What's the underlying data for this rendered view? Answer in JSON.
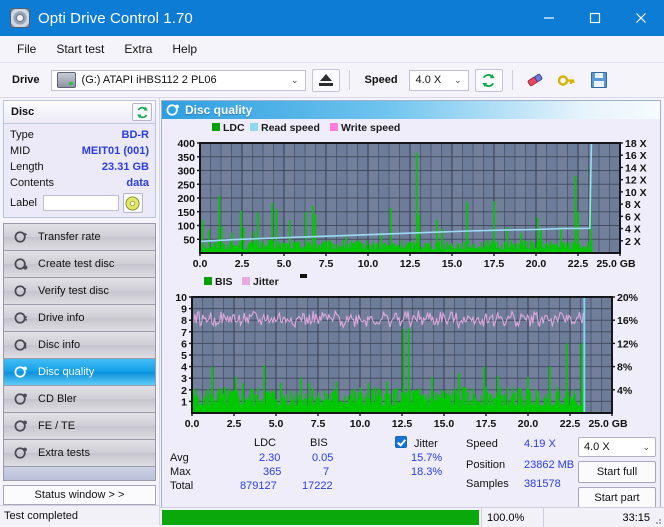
{
  "window": {
    "title": "Opti Drive Control 1.70",
    "app_icon": "disc-icon",
    "minimize": "–",
    "maximize": "□",
    "close": "✕"
  },
  "menu": {
    "items": [
      {
        "label": "File"
      },
      {
        "label": "Start test"
      },
      {
        "label": "Extra"
      },
      {
        "label": "Help"
      }
    ]
  },
  "toolbar": {
    "drive_label": "Drive",
    "drive_value": "(G:)  ATAPI iHBS112  2 PL06",
    "eject_icon": "eject-icon",
    "speed_label": "Speed",
    "speed_value": "4.0 X",
    "refresh_icon": "refresh-icon",
    "eraser_icon": "eraser-icon",
    "key_icon": "key-icon",
    "save_icon": "save-icon"
  },
  "sidebar": {
    "disc_panel": {
      "title": "Disc",
      "refresh_icon": "refresh-icon",
      "rows": [
        {
          "key": "Type",
          "value": "BD-R"
        },
        {
          "key": "MID",
          "value": "MEIT01 (001)"
        },
        {
          "key": "Length",
          "value": "23.31 GB"
        },
        {
          "key": "Contents",
          "value": "data"
        }
      ],
      "label_key": "Label",
      "label_value": "",
      "label_placeholder": "",
      "disc_icon": "cd-icon"
    },
    "nav_items": [
      {
        "label": "Transfer rate",
        "icon": "disc-test-icon",
        "active": false
      },
      {
        "label": "Create test disc",
        "icon": "disc-burn-icon",
        "active": false
      },
      {
        "label": "Verify test disc",
        "icon": "disc-verify-icon",
        "active": false
      },
      {
        "label": "Drive info",
        "icon": "drive-info-icon",
        "active": false
      },
      {
        "label": "Disc info",
        "icon": "disc-info-icon",
        "active": false
      },
      {
        "label": "Disc quality",
        "icon": "disc-quality-icon",
        "active": true
      },
      {
        "label": "CD Bler",
        "icon": "cd-bler-icon",
        "active": false
      },
      {
        "label": "FE / TE",
        "icon": "fe-te-icon",
        "active": false
      },
      {
        "label": "Extra tests",
        "icon": "extra-tests-icon",
        "active": false
      }
    ],
    "status_window_button": "Status window > >",
    "test_status": "Test completed"
  },
  "panel": {
    "title": "Disc quality",
    "icon": "disc-quality-icon"
  },
  "stats": {
    "col_headers": [
      "LDC",
      "BIS"
    ],
    "row_labels": [
      "Avg",
      "Max",
      "Total"
    ],
    "ldc": {
      "avg": "2.30",
      "max": "365",
      "total": "879127"
    },
    "bis": {
      "avg": "0.05",
      "max": "7",
      "total": "17222"
    },
    "jitter": {
      "label": "Jitter",
      "checked": true,
      "avg": "15.7%",
      "max": "18.3%"
    },
    "speed_label": "Speed",
    "speed_value": "4.19 X",
    "position_label": "Position",
    "position_value": "23862 MB",
    "samples_label": "Samples",
    "samples_value": "381578",
    "speed_select": "4.0 X",
    "start_full": "Start full",
    "start_part": "Start part"
  },
  "statusbar": {
    "progress_percent": 100,
    "percent_text": "100.0%",
    "elapsed": "33:15"
  },
  "chart_data": [
    {
      "type": "line",
      "name": "disc-quality-ldc-chart",
      "title": "",
      "xlabel": "GB",
      "ylabel": "LDC",
      "xlim": [
        0,
        25
      ],
      "xticks": [
        "0.0",
        "2.5",
        "5.0",
        "7.5",
        "10.0",
        "12.5",
        "15.0",
        "17.5",
        "20.0",
        "22.5",
        "25.0 GB"
      ],
      "ylim": [
        0,
        400
      ],
      "yticks": [
        "50",
        "100",
        "150",
        "200",
        "250",
        "300",
        "350",
        "400"
      ],
      "y2lim": [
        0,
        18
      ],
      "y2ticks": [
        "2 X",
        "4 X",
        "6 X",
        "8 X",
        "10 X",
        "12 X",
        "14 X",
        "16 X",
        "18 X"
      ],
      "legend": [
        {
          "label": "LDC",
          "color": "#00a000"
        },
        {
          "label": "Read speed",
          "color": "#8fd8f2"
        },
        {
          "label": "Write speed",
          "color": "#ff7fe0"
        }
      ],
      "legend_position": "top-left",
      "grid": true,
      "series": [
        {
          "name": "LDC",
          "color": "#00c800",
          "type": "impulse",
          "baseline_avg": 25,
          "peaks": [
            {
              "x": 0.15,
              "y": 120
            },
            {
              "x": 0.55,
              "y": 85
            },
            {
              "x": 1.15,
              "y": 208
            },
            {
              "x": 1.3,
              "y": 95
            },
            {
              "x": 1.9,
              "y": 75
            },
            {
              "x": 2.45,
              "y": 152
            },
            {
              "x": 2.6,
              "y": 92
            },
            {
              "x": 3.2,
              "y": 78
            },
            {
              "x": 3.45,
              "y": 148
            },
            {
              "x": 4.3,
              "y": 183
            },
            {
              "x": 4.55,
              "y": 160
            },
            {
              "x": 5.35,
              "y": 120
            },
            {
              "x": 6.3,
              "y": 149
            },
            {
              "x": 6.7,
              "y": 172
            },
            {
              "x": 6.85,
              "y": 140
            },
            {
              "x": 8.7,
              "y": 60
            },
            {
              "x": 10.8,
              "y": 72
            },
            {
              "x": 11.35,
              "y": 163
            },
            {
              "x": 12.9,
              "y": 365
            },
            {
              "x": 13.05,
              "y": 140
            },
            {
              "x": 14.1,
              "y": 120
            },
            {
              "x": 14.4,
              "y": 88
            },
            {
              "x": 15.9,
              "y": 185
            },
            {
              "x": 17.5,
              "y": 188
            },
            {
              "x": 18.3,
              "y": 95
            },
            {
              "x": 19.1,
              "y": 72
            },
            {
              "x": 20.1,
              "y": 130
            },
            {
              "x": 20.3,
              "y": 85
            },
            {
              "x": 21.5,
              "y": 95
            },
            {
              "x": 22.35,
              "y": 281
            },
            {
              "x": 22.5,
              "y": 150
            },
            {
              "x": 23.25,
              "y": 315
            }
          ]
        },
        {
          "name": "Read speed",
          "color": "#9bdcf5",
          "type": "line",
          "points": [
            {
              "x": 0.0,
              "y": 1.9
            },
            {
              "x": 2.0,
              "y": 2.2
            },
            {
              "x": 4.0,
              "y": 2.4
            },
            {
              "x": 6.0,
              "y": 2.6
            },
            {
              "x": 8.0,
              "y": 2.8
            },
            {
              "x": 10.0,
              "y": 3.0
            },
            {
              "x": 12.0,
              "y": 3.2
            },
            {
              "x": 14.0,
              "y": 3.4
            },
            {
              "x": 16.0,
              "y": 3.6
            },
            {
              "x": 18.0,
              "y": 3.75
            },
            {
              "x": 20.0,
              "y": 3.85
            },
            {
              "x": 21.5,
              "y": 4.0
            },
            {
              "x": 23.2,
              "y": 4.05
            },
            {
              "x": 23.3,
              "y": 18.0
            }
          ]
        }
      ]
    },
    {
      "type": "line",
      "name": "disc-quality-bis-jitter-chart",
      "title": "",
      "xlabel": "GB",
      "ylabel": "BIS",
      "xlim": [
        0,
        25
      ],
      "xticks": [
        "0.0",
        "2.5",
        "5.0",
        "7.5",
        "10.0",
        "12.5",
        "15.0",
        "17.5",
        "20.0",
        "22.5",
        "25.0 GB"
      ],
      "ylim": [
        0,
        10
      ],
      "yticks": [
        "1",
        "2",
        "3",
        "4",
        "5",
        "6",
        "7",
        "8",
        "9",
        "10"
      ],
      "y2lim": [
        0,
        20
      ],
      "y2ticks": [
        "4%",
        "8%",
        "12%",
        "16%",
        "20%"
      ],
      "legend": [
        {
          "label": "BIS",
          "color": "#00a000"
        },
        {
          "label": "Jitter",
          "color": "#e8a8e0"
        }
      ],
      "legend_position": "top-left",
      "grid": true,
      "series": [
        {
          "name": "BIS",
          "color": "#00c800",
          "type": "impulse",
          "baseline_avg": 1.2,
          "peaks": [
            {
              "x": 1.2,
              "y": 4.0
            },
            {
              "x": 2.6,
              "y": 3.1
            },
            {
              "x": 3.05,
              "y": 2.6
            },
            {
              "x": 4.3,
              "y": 4.1
            },
            {
              "x": 5.3,
              "y": 2.6
            },
            {
              "x": 6.5,
              "y": 3.0
            },
            {
              "x": 7.0,
              "y": 2.6
            },
            {
              "x": 8.6,
              "y": 2.7
            },
            {
              "x": 10.5,
              "y": 2.6
            },
            {
              "x": 11.6,
              "y": 2.7
            },
            {
              "x": 12.6,
              "y": 7.2
            },
            {
              "x": 12.9,
              "y": 7.3
            },
            {
              "x": 14.3,
              "y": 3.1
            },
            {
              "x": 15.9,
              "y": 3.4
            },
            {
              "x": 17.4,
              "y": 4.0
            },
            {
              "x": 18.2,
              "y": 3.2
            },
            {
              "x": 20.0,
              "y": 3.1
            },
            {
              "x": 21.3,
              "y": 4.0
            },
            {
              "x": 22.3,
              "y": 6.0
            },
            {
              "x": 23.2,
              "y": 6.0
            }
          ]
        },
        {
          "name": "Jitter",
          "color": "#dfa8dc",
          "type": "noisy-line",
          "mean": 8.1,
          "amplitude": 0.55,
          "x_start": 0.1,
          "x_end": 23.3
        },
        {
          "name": "cursor",
          "color": "#7fdcf5",
          "type": "vline",
          "x": 23.35
        }
      ]
    }
  ]
}
